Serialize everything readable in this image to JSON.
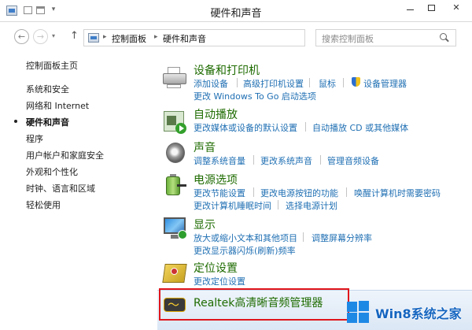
{
  "window": {
    "title": "硬件和声音",
    "min_label": "—",
    "close_label": "✕"
  },
  "nav": {
    "back_label": "←",
    "forward_label": "→",
    "up_label": "↑",
    "breadcrumbs": [
      "控制面板",
      "硬件和声音"
    ],
    "search_placeholder": "搜索控制面板"
  },
  "sidebar": {
    "items": [
      {
        "label": "控制面板主页"
      },
      {
        "label": "系统和安全"
      },
      {
        "label": "网络和 Internet"
      },
      {
        "label": "硬件和声音",
        "current": true
      },
      {
        "label": "程序"
      },
      {
        "label": "用户帐户和家庭安全"
      },
      {
        "label": "外观和个性化"
      },
      {
        "label": "时钟、语言和区域"
      },
      {
        "label": "轻松使用"
      }
    ]
  },
  "categories": [
    {
      "title": "设备和打印机",
      "icon": "printer-icon",
      "row1": [
        "添加设备",
        "高级打印机设置",
        "鼠标",
        "设备管理器"
      ],
      "row2": [
        "更改 Windows To Go 启动选项"
      ]
    },
    {
      "title": "自动播放",
      "icon": "autoplay-icon",
      "row1": [
        "更改媒体或设备的默认设置",
        "自动播放 CD 或其他媒体"
      ],
      "row2": []
    },
    {
      "title": "声音",
      "icon": "speaker-icon",
      "row1": [
        "调整系统音量",
        "更改系统声音",
        "管理音频设备"
      ],
      "row2": []
    },
    {
      "title": "电源选项",
      "icon": "power-icon",
      "row1": [
        "更改节能设置",
        "更改电源按钮的功能",
        "唤醒计算机时需要密码"
      ],
      "row2": [
        "更改计算机睡眠时间",
        "选择电源计划"
      ]
    },
    {
      "title": "显示",
      "icon": "display-icon",
      "row1": [
        "放大或缩小文本和其他项目",
        "调整屏幕分辨率"
      ],
      "row2": [
        "更改显示器闪烁(刷新)频率"
      ]
    },
    {
      "title": "定位设置",
      "icon": "location-icon",
      "row1": [
        "更改定位设置"
      ],
      "row2": []
    },
    {
      "title": "Realtek高清晰音频管理器",
      "icon": "realtek-audio-icon",
      "row1": [],
      "row2": []
    }
  ],
  "watermark": {
    "text": "Win8系统之家"
  },
  "colors": {
    "category_title": "#1e6b00",
    "link": "#1f6fb3",
    "highlight_border": "#e0161c"
  }
}
